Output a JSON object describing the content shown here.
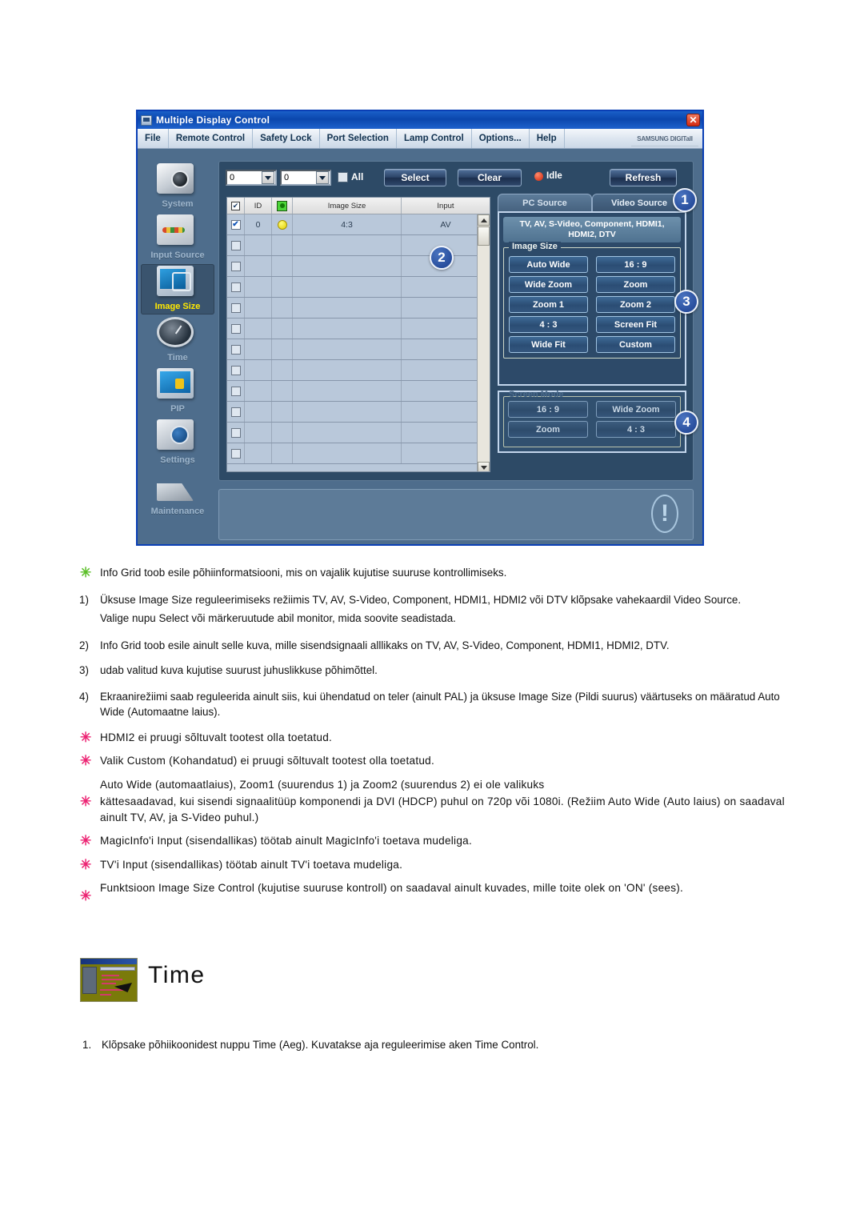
{
  "app": {
    "title": "Multiple Display Control",
    "close_label": "✕",
    "menu": [
      "File",
      "Remote Control",
      "Safety Lock",
      "Port Selection",
      "Lamp Control",
      "Options...",
      "Help"
    ],
    "brand": "SAMSUNG DIGITall",
    "sidebar": [
      {
        "label": "System",
        "icon": "system-icon"
      },
      {
        "label": "Input Source",
        "icon": "input-source-icon"
      },
      {
        "label": "Image Size",
        "icon": "image-size-icon"
      },
      {
        "label": "Time",
        "icon": "clock-icon"
      },
      {
        "label": "PIP",
        "icon": "pip-icon"
      },
      {
        "label": "Settings",
        "icon": "settings-cube-icon"
      },
      {
        "label": "Maintenance",
        "icon": "maintenance-icon"
      }
    ],
    "toolbar": {
      "combo1_value": "0",
      "combo2_value": "0",
      "all_label": "All",
      "select_label": "Select",
      "clear_label": "Clear",
      "status_label": "Idle",
      "refresh_label": "Refresh"
    },
    "grid": {
      "headers": [
        "",
        "ID",
        "",
        "Image Size",
        "Input"
      ],
      "rows": [
        {
          "checked": true,
          "id": "0",
          "power": "on",
          "image_size": "4:3",
          "input": "AV"
        },
        {
          "checked": false,
          "id": "",
          "power": "",
          "image_size": "",
          "input": ""
        },
        {
          "checked": false,
          "id": "",
          "power": "",
          "image_size": "",
          "input": ""
        },
        {
          "checked": false,
          "id": "",
          "power": "",
          "image_size": "",
          "input": ""
        },
        {
          "checked": false,
          "id": "",
          "power": "",
          "image_size": "",
          "input": ""
        },
        {
          "checked": false,
          "id": "",
          "power": "",
          "image_size": "",
          "input": ""
        },
        {
          "checked": false,
          "id": "",
          "power": "",
          "image_size": "",
          "input": ""
        },
        {
          "checked": false,
          "id": "",
          "power": "",
          "image_size": "",
          "input": ""
        },
        {
          "checked": false,
          "id": "",
          "power": "",
          "image_size": "",
          "input": ""
        },
        {
          "checked": false,
          "id": "",
          "power": "",
          "image_size": "",
          "input": ""
        },
        {
          "checked": false,
          "id": "",
          "power": "",
          "image_size": "",
          "input": ""
        },
        {
          "checked": false,
          "id": "",
          "power": "",
          "image_size": "",
          "input": ""
        }
      ]
    },
    "source": {
      "tab_pc": "PC Source",
      "tab_video": "Video Source",
      "signal_list": "TV, AV, S-Video, Component, HDMI1, HDMI2, DTV",
      "image_size_legend": "Image Size",
      "image_size_buttons": [
        "Auto Wide",
        "16 : 9",
        "Wide Zoom",
        "Zoom",
        "Zoom 1",
        "Zoom 2",
        "4 : 3",
        "Screen Fit",
        "Wide Fit",
        "Custom"
      ],
      "screen_mode_legend": "Screen Mode",
      "screen_mode_buttons": [
        "16 : 9",
        "Wide Zoom",
        "Zoom",
        "4 : 3"
      ]
    },
    "callouts": [
      "1",
      "2",
      "3",
      "4"
    ]
  },
  "doc": {
    "bullets": [
      {
        "marker": "star-green",
        "text": "Info Grid toob esile põhiinformatsiooni, mis on vajalik kujutise suuruse kontrollimiseks."
      },
      {
        "marker": "1)",
        "text": "Üksuse Image Size reguleerimiseks režiimis TV, AV, S-Video, Component, HDMI1, HDMI2 või DTV klõpsake vahekaardil Video Source."
      },
      {
        "marker": "",
        "text": "Valige nupu Select või märkeruutude abil monitor, mida soovite seadistada."
      },
      {
        "marker": "2)",
        "text": "Info Grid toob esile ainult selle kuva, mille sisendsignaali alllikaks on TV, AV, S-Video, Component, HDMI1, HDMI2, DTV."
      },
      {
        "marker": "3)",
        "text": "udab valitud kuva kujutise suurust juhuslikkuse põhimõttel."
      },
      {
        "marker": "4)",
        "text": "Ekraanirežiimi saab reguleerida ainult siis, kui ühendatud on teler (ainult PAL) ja üksuse Image Size (Pildi suurus) väärtuseks on määratud Auto Wide (Automaatne laius)."
      },
      {
        "marker": "star-pink",
        "text": "HDMI2 ei pruugi sõltuvalt tootest olla toetatud."
      },
      {
        "marker": "star-pink",
        "text": "Valik Custom (Kohandatud) ei pruugi sõltuvalt tootest olla toetatud."
      },
      {
        "marker": "",
        "text": "Auto Wide (automaatlaius), Zoom1 (suurendus 1) ja Zoom2 (suurendus 2) ei ole valikuks"
      },
      {
        "marker": "star-pink",
        "text": "kättesaadavad, kui sisendi signaalitüüp komponendi ja DVI (HDCP) puhul on 720p või 1080i. (Režiim Auto Wide (Auto laius) on saadaval ainult TV, AV, ja S-Video puhul.)"
      },
      {
        "marker": "star-pink",
        "text": "MagicInfo'i Input (sisendallikas) töötab ainult MagicInfo'i toetava mudeliga."
      },
      {
        "marker": "star-pink",
        "text": "TV'i Input (sisendallikas) töötab ainult TV'i toetava mudeliga."
      },
      {
        "marker": "star-pink",
        "text": "Funktsioon Image Size Control (kujutise suuruse kontroll) on saadaval ainult kuvades, mille toite olek on 'ON' (sees)."
      }
    ],
    "section_title": "Time",
    "footer_step_number": "1.",
    "footer_step_text": "Klõpsake põhiikoonidest nuppu Time (Aeg). Kuvatakse aja reguleerimise aken Time Control."
  },
  "colors": {
    "accent_blue": "#1b3f8f",
    "star_green": "#5bbf28",
    "star_pink": "#ec2473",
    "window_border": "#0a3fb5",
    "highlight_yellow": "#ffe800"
  }
}
